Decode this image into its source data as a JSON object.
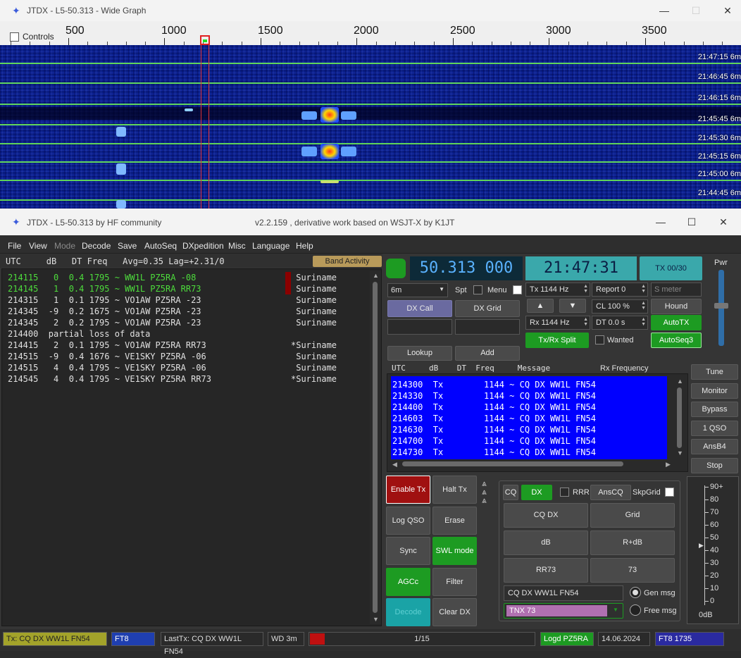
{
  "wide_graph": {
    "title": "JTDX - L5-50.313 - Wide Graph",
    "controls_label": "Controls",
    "scale_labels": [
      "500",
      "1000",
      "1500",
      "2000",
      "2500",
      "3000",
      "3500"
    ],
    "times": [
      "21:47:15",
      "21:46:45",
      "21:46:15",
      "21:45:45",
      "21:45:30",
      "21:45:15",
      "21:45:00",
      "21:44:45"
    ],
    "band": "6m"
  },
  "main": {
    "title": "JTDX - L5-50.313  by HF community",
    "version": "v2.2.159 , derivative work based on WSJT-X by K1JT",
    "menu": [
      "File",
      "View",
      "Mode",
      "Decode",
      "Save",
      "AutoSeq",
      "DXpedition",
      "Misc",
      "Language",
      "Help"
    ],
    "decode_header": "UTC     dB   DT Freq   Avg=0.35 Lag=+2.31/0",
    "band_activity": "Band Activity",
    "decodes": [
      {
        "text": "214115   0  0.4 1795 ~ WW1L PZ5RA -08",
        "country": " Suriname",
        "green": true,
        "mark": true
      },
      {
        "text": "214145   1  0.4 1795 ~ WW1L PZ5RA RR73",
        "country": " Suriname",
        "green": true,
        "mark": true
      },
      {
        "text": "214315   1  0.1 1795 ~ VO1AW PZ5RA -23",
        "country": " Suriname",
        "green": false,
        "mark": false
      },
      {
        "text": "214345  -9  0.2 1675 ~ VO1AW PZ5RA -23",
        "country": " Suriname",
        "green": false,
        "mark": false
      },
      {
        "text": "214345   2  0.2 1795 ~ VO1AW PZ5RA -23",
        "country": " Suriname",
        "green": false,
        "mark": false
      },
      {
        "text": "214400  partial loss of data",
        "country": "",
        "green": false,
        "mark": false
      },
      {
        "text": "214415   2  0.1 1795 ~ VO1AW PZ5RA RR73",
        "country": "*Suriname",
        "green": false,
        "mark": false
      },
      {
        "text": "214515  -9  0.4 1676 ~ VE1SKY PZ5RA -06",
        "country": " Suriname",
        "green": false,
        "mark": false
      },
      {
        "text": "214515   4  0.4 1795 ~ VE1SKY PZ5RA -06",
        "country": " Suriname",
        "green": false,
        "mark": false
      },
      {
        "text": "214545   4  0.4 1795 ~ VE1SKY PZ5RA RR73",
        "country": "*Suriname",
        "green": false,
        "mark": false
      }
    ],
    "frequency": "50.313 000",
    "clock": "21:47:31",
    "tx_counter": "TX 00/30",
    "pwr_label": "Pwr",
    "band_select": "6m",
    "spt": "Spt",
    "menu_cb": "Menu",
    "dx_call": "DX Call",
    "dx_grid": "DX Grid",
    "lookup": "Lookup",
    "add": "Add",
    "tx_freq": "Tx  1144  Hz",
    "rx_freq": "Rx  1144  Hz",
    "report": "Report 0",
    "s_meter": "S meter",
    "cl": "CL  100 %",
    "dt": "DT 0.0 s",
    "hound": "Hound",
    "autotx": "AutoTX",
    "txrx_split": "Tx/Rx Split",
    "wanted": "Wanted",
    "autoseq3": "AutoSeq3",
    "up_arrow": "▲",
    "down_arrow": "▼",
    "tx_header": "UTC     dB    DT  Freq     Message",
    "rx_freq_label": "Rx Frequency",
    "tx_rows": [
      "214300  Tx        1144 ~ CQ DX WW1L FN54",
      "214330  Tx        1144 ~ CQ DX WW1L FN54",
      "214400  Tx        1144 ~ CQ DX WW1L FN54",
      "214603  Tx        1144 ~ CQ DX WW1L FN54",
      "214630  Tx        1144 ~ CQ DX WW1L FN54",
      "214700  Tx        1144 ~ CQ DX WW1L FN54",
      "214730  Tx        1144 ~ CQ DX WW1L FN54"
    ],
    "side_buttons": [
      "Tune",
      "Monitor",
      "Bypass",
      "1 QSO",
      "AnsB4",
      "Stop"
    ],
    "ctl_buttons": [
      "Enable Tx",
      "Halt Tx",
      "Log QSO",
      "Erase",
      "Sync",
      "SWL mode",
      "AGCc",
      "Filter",
      "Decode",
      "Clear DX"
    ],
    "cq": "CQ",
    "dx": "DX",
    "rrr": "RRR",
    "anscq": "AnsCQ",
    "skpgrid": "SkpGrid",
    "msg_buttons": [
      "CQ DX",
      "Grid",
      "dB",
      "R+dB",
      "RR73",
      "73"
    ],
    "gen_field": "CQ DX WW1L FN54",
    "free_field": "TNX 73",
    "gen_msg": "Gen msg",
    "free_msg": "Free msg",
    "meter_ticks": [
      "90+",
      "80",
      "70",
      "60",
      "50",
      "40",
      "30",
      "20",
      "10",
      "0"
    ],
    "meter_db": "0dB",
    "status": {
      "tx": "Tx: CQ DX WW1L FN54",
      "mode": "FT8",
      "last_tx": "LastTx: CQ DX WW1L FN54",
      "wd": "WD 3m",
      "progress": "1/15",
      "logd": "Logd PZ5RA",
      "date": "14.06.2024",
      "mode2": "FT8  1735"
    }
  },
  "colors": {
    "accent_green": "#1d9b22",
    "freq_blue": "#5ab2ff",
    "clock_teal": "#3aa8ab",
    "enable_tx_red": "#a01010"
  }
}
